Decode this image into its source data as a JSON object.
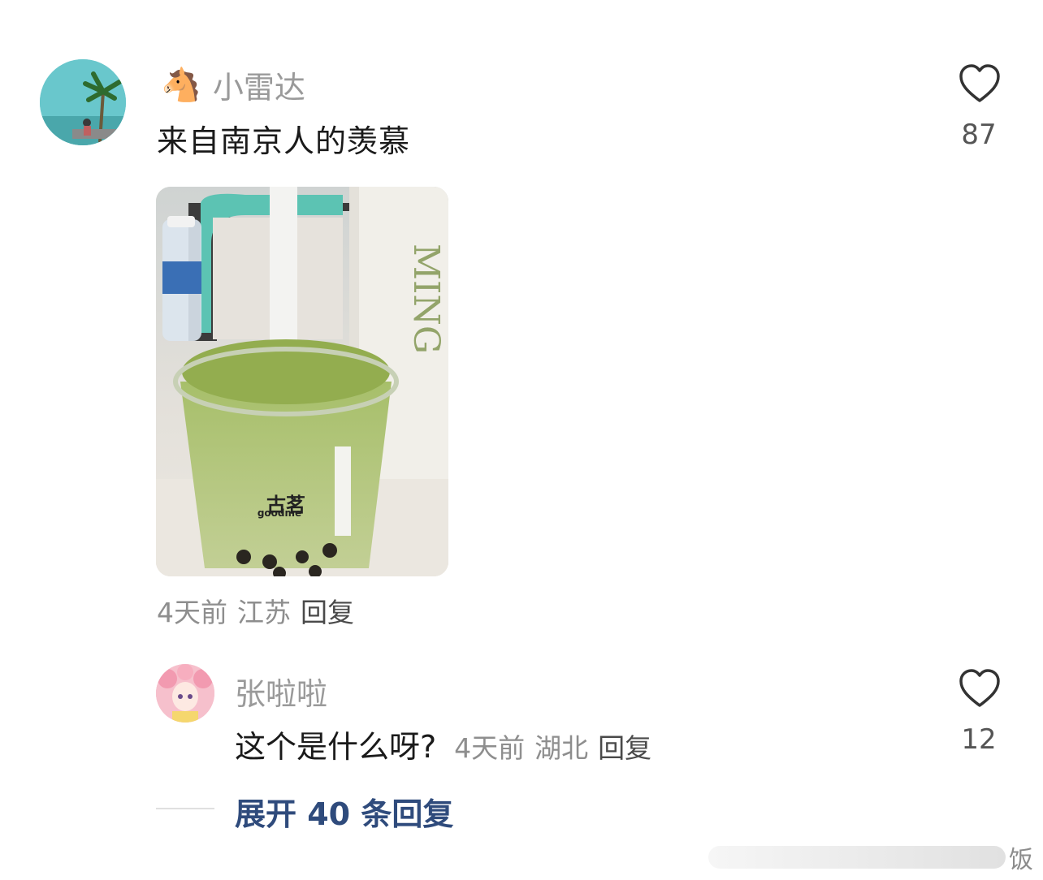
{
  "comment": {
    "username": "小雷达",
    "username_emoji": "🐴",
    "text": "来自南京人的羡慕",
    "likes": "87",
    "time": "4天前",
    "location": "江苏",
    "reply_label": "回复",
    "photo": {
      "cup_text": "古茗",
      "cup_brand": "goodme",
      "bag_text": "MING"
    }
  },
  "reply": {
    "username": "张啦啦",
    "text": "这个是什么呀?",
    "time": "4天前",
    "location": "湖北",
    "reply_label": "回复",
    "likes": "12"
  },
  "expand": {
    "label": "展开 40 条回复"
  },
  "watermark": {
    "text": "饭"
  },
  "colors": {
    "username": "#9a9a9a",
    "meta": "#8e8e8e",
    "expand_link": "#2f4b7c"
  }
}
